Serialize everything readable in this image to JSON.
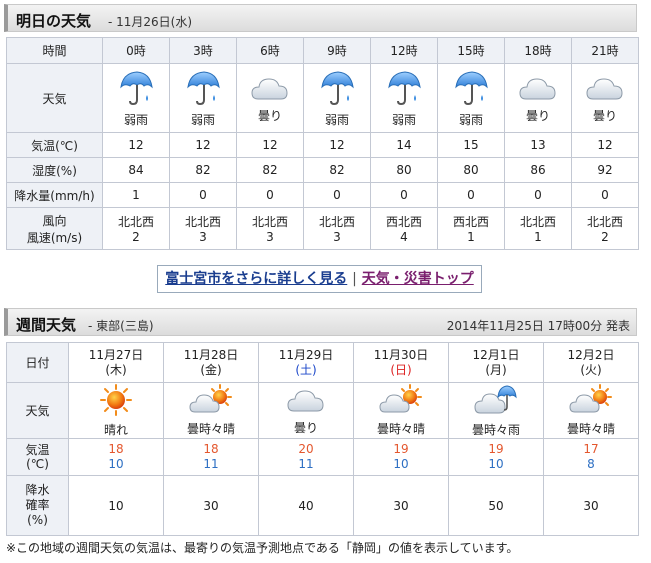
{
  "tomorrow": {
    "title": "明日の天気",
    "date": "- 11月26日(水)",
    "row_labels": {
      "time": "時間",
      "weather": "天気",
      "temp": "気温(℃)",
      "humidity": "湿度(%)",
      "precip": "降水量(mm/h)",
      "wind_dir": "風向",
      "wind_speed": "風速(m/s)"
    },
    "hours": [
      {
        "time": "0時",
        "icon": "umbrella-rain-icon",
        "cond": "弱雨",
        "temp": "12",
        "humidity": "84",
        "precip": "1",
        "wind_dir": "北北西",
        "wind_speed": "2"
      },
      {
        "time": "3時",
        "icon": "umbrella-rain-icon",
        "cond": "弱雨",
        "temp": "12",
        "humidity": "82",
        "precip": "0",
        "wind_dir": "北北西",
        "wind_speed": "3"
      },
      {
        "time": "6時",
        "icon": "cloud-icon",
        "cond": "曇り",
        "temp": "12",
        "humidity": "82",
        "precip": "0",
        "wind_dir": "北北西",
        "wind_speed": "3"
      },
      {
        "time": "9時",
        "icon": "umbrella-rain-icon",
        "cond": "弱雨",
        "temp": "12",
        "humidity": "82",
        "precip": "0",
        "wind_dir": "北北西",
        "wind_speed": "3"
      },
      {
        "time": "12時",
        "icon": "umbrella-rain-icon",
        "cond": "弱雨",
        "temp": "14",
        "humidity": "80",
        "precip": "0",
        "wind_dir": "西北西",
        "wind_speed": "4"
      },
      {
        "time": "15時",
        "icon": "umbrella-rain-icon",
        "cond": "弱雨",
        "temp": "15",
        "humidity": "80",
        "precip": "0",
        "wind_dir": "西北西",
        "wind_speed": "1"
      },
      {
        "time": "18時",
        "icon": "cloud-icon",
        "cond": "曇り",
        "temp": "13",
        "humidity": "86",
        "precip": "0",
        "wind_dir": "北北西",
        "wind_speed": "1"
      },
      {
        "time": "21時",
        "icon": "cloud-icon",
        "cond": "曇り",
        "temp": "12",
        "humidity": "92",
        "precip": "0",
        "wind_dir": "北北西",
        "wind_speed": "2"
      }
    ]
  },
  "links": {
    "detail": "富士宮市をさらに詳しく見る",
    "separator": "|",
    "top": "天気・災害トップ"
  },
  "weekly": {
    "title": "週間天気",
    "region": "- 東部(三島)",
    "issued": "2014年11月25日 17時00分 発表",
    "row_labels": {
      "date": "日付",
      "weather": "天気",
      "temp": "気温\n(℃)",
      "rain_prob": "降水\n確率\n(%)"
    },
    "days": [
      {
        "date": "11月27日",
        "dow": "(木)",
        "dow_type": "weekday",
        "icon": "sun-icon",
        "cond": "晴れ",
        "high": "18",
        "low": "10",
        "prob": "10"
      },
      {
        "date": "11月28日",
        "dow": "(金)",
        "dow_type": "weekday",
        "icon": "cloud-sun-icon",
        "cond": "曇時々晴",
        "high": "18",
        "low": "11",
        "prob": "30"
      },
      {
        "date": "11月29日",
        "dow": "(土)",
        "dow_type": "saturday",
        "icon": "cloud-icon",
        "cond": "曇り",
        "high": "20",
        "low": "11",
        "prob": "40"
      },
      {
        "date": "11月30日",
        "dow": "(日)",
        "dow_type": "sunday",
        "icon": "cloud-sun-icon",
        "cond": "曇時々晴",
        "high": "19",
        "low": "10",
        "prob": "30"
      },
      {
        "date": "12月1日",
        "dow": "(月)",
        "dow_type": "weekday",
        "icon": "cloud-rain-icon",
        "cond": "曇時々雨",
        "high": "19",
        "low": "10",
        "prob": "50"
      },
      {
        "date": "12月2日",
        "dow": "(火)",
        "dow_type": "weekday",
        "icon": "cloud-sun-icon",
        "cond": "曇時々晴",
        "high": "17",
        "low": "8",
        "prob": "30"
      }
    ]
  },
  "footnote": "※この地域の週間天気の気温は、最寄りの気温予測地点である「静岡」の値を表示しています。",
  "colors": {
    "high": "#e4572e",
    "low": "#2d6fc3",
    "link": "#1a3d8f",
    "link_visited": "#7a1f6e"
  }
}
